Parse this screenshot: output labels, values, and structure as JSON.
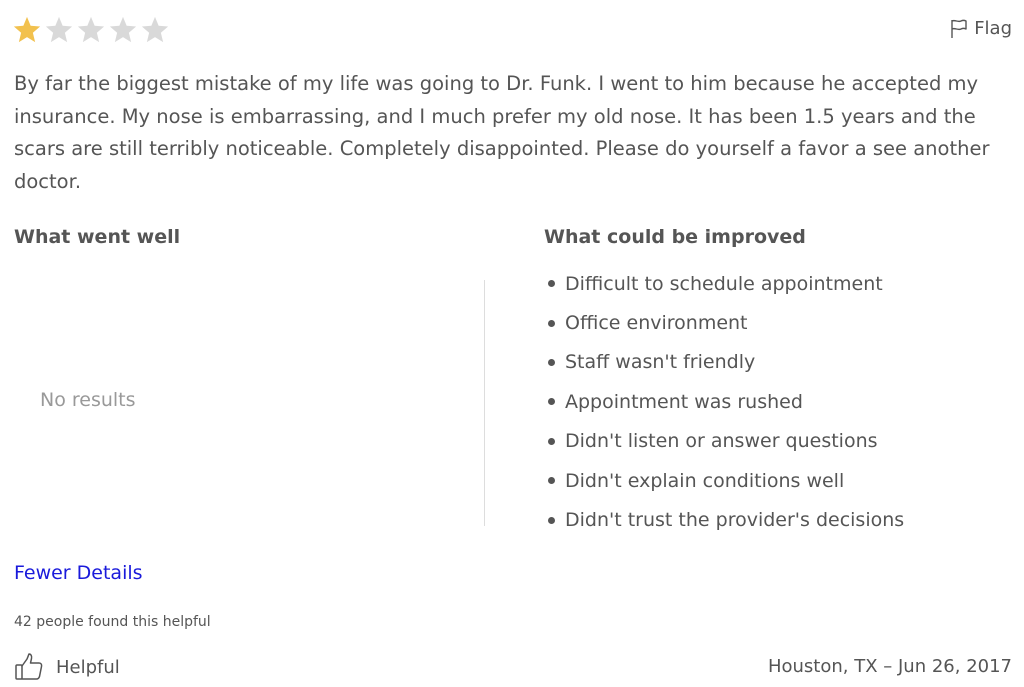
{
  "review": {
    "rating": 1,
    "max_rating": 5,
    "star_filled_color": "#f2c14e",
    "star_empty_color": "#d9d9d9",
    "text": "By far the biggest mistake of my life was going to Dr. Funk. I went to him because he accepted my insurance. My nose is embarrassing, and I much prefer my old nose. It has been 1.5 years and the scars are still terribly noticeable. Completely disappointed. Please do yourself a favor a see another doctor."
  },
  "flag": {
    "icon": "flag-icon",
    "label": "Flag"
  },
  "went_well": {
    "heading": "What went well",
    "empty_text": "No results"
  },
  "could_improve": {
    "heading": "What could be improved",
    "items": [
      "Difficult to schedule appointment",
      "Office environment",
      "Staff wasn't friendly",
      "Appointment was rushed",
      "Didn't listen or answer questions",
      "Didn't explain conditions well",
      "Didn't trust the provider's decisions"
    ]
  },
  "details_toggle": {
    "label": "Fewer Details",
    "link_color": "#1a1adb"
  },
  "footer": {
    "helpful_count_text": "42 people found this helpful",
    "helpful_icon": "thumbs-up-icon",
    "helpful_label": "Helpful",
    "location_date": "Houston, TX – Jun 26, 2017"
  }
}
